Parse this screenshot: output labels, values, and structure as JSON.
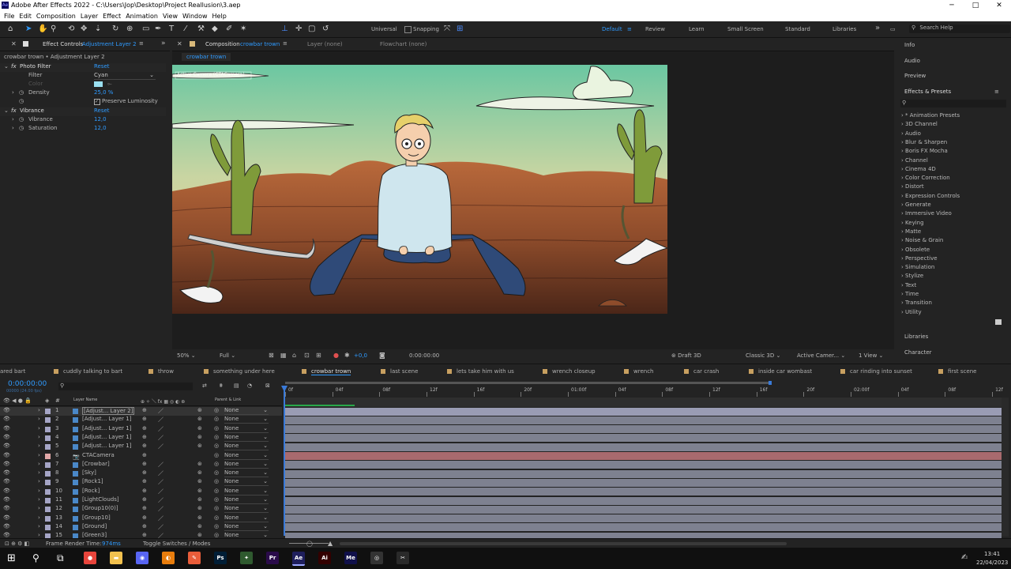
{
  "titlebar": {
    "app_initial": "Ae",
    "title": "Adobe After Effects 2022 - C:\\Users\\Jop\\Desktop\\Project Reallusion\\3.aep",
    "minimize": "─",
    "maximize": "□",
    "close": "✕"
  },
  "menu": [
    "File",
    "Edit",
    "Composition",
    "Layer",
    "Effect",
    "Animation",
    "View",
    "Window",
    "Help"
  ],
  "toolbar": {
    "universal_label": "Universal",
    "snapping_label": "Snapping",
    "search_label": "Search Help",
    "workspaces": [
      "Default",
      "Review",
      "Learn",
      "Small Screen",
      "Standard",
      "Libraries"
    ],
    "more": "»"
  },
  "effect_controls": {
    "tab_prefix": "Effect Controls",
    "tab_layer": "Adjustment Layer 2",
    "layer_path": "crowbar trown • Adjustment Layer 2",
    "fx": [
      {
        "name": "Photo Filter",
        "reset": "Reset"
      },
      {
        "name": "Vibrance",
        "reset": "Reset"
      }
    ],
    "photo_filter_rows": {
      "filter_label": "Filter",
      "filter_value": "Cyan",
      "color_label": "Color",
      "density_label": "Density",
      "density_value": "25,0 %",
      "preserve_label": "Preserve Luminosity"
    },
    "vibrance_rows": {
      "vibrance_label": "Vibrance",
      "vibrance_value": "12,0",
      "saturation_label": "Saturation",
      "saturation_value": "12,0"
    }
  },
  "viewer": {
    "comp_tab_prefix": "Composition",
    "comp_tab_name": "crowbar trown",
    "layer_tab": "Layer (none)",
    "flowchart_tab": "Flowchart (none)",
    "sub_tab": "crowbar trown",
    "overlay_text": "Active Camera (CTACamera)",
    "bottom": {
      "zoom": "50%",
      "quality": "Full",
      "exposure": "+0,0",
      "timecode": "0:00:00:00",
      "renderer": "Draft 3D",
      "renderer_mode": "Classic 3D",
      "camera": "Active Camer...",
      "views": "1 View"
    }
  },
  "right_panel": {
    "top_items": [
      "Info",
      "Audio",
      "Preview"
    ],
    "effects_title": "Effects & Presets",
    "effects": [
      "* Animation Presets",
      "3D Channel",
      "Audio",
      "Blur & Sharpen",
      "Boris FX Mocha",
      "Channel",
      "Cinema 4D",
      "Color Correction",
      "Distort",
      "Expression Controls",
      "Generate",
      "Immersive Video",
      "Keying",
      "Matte",
      "Noise & Grain",
      "Obsolete",
      "Perspective",
      "Simulation",
      "Stylize",
      "Text",
      "Time",
      "Transition",
      "Utility"
    ],
    "bottom_items": [
      "Libraries",
      "Character"
    ]
  },
  "timeline_tabs": [
    "ared bart",
    "cuddly talking to bart",
    "throw",
    "something under here",
    "crowbar trown",
    "last scene",
    "lets take him with us",
    "wrench closeup",
    "wrench",
    "car crash",
    "inside car wombast",
    "car rinding into sunset",
    "first scene"
  ],
  "timeline": {
    "timecode": "0:00:00:00",
    "fps": "00000 (24.00 fps)",
    "col_layer_name": "Layer Name",
    "col_num": "#",
    "col_parent": "Parent & Link",
    "ruler": [
      "0f",
      "04f",
      "08f",
      "12f",
      "16f",
      "20f",
      "01:00f",
      "04f",
      "08f",
      "12f",
      "16f",
      "20f",
      "02:00f",
      "04f",
      "08f",
      "12f"
    ],
    "layers": [
      {
        "num": "1",
        "name": "[Adjust... Layer 2]",
        "parent": "None",
        "color": "#a5a5c6",
        "selected": true
      },
      {
        "num": "2",
        "name": "[Adjust... Layer 1]",
        "parent": "None",
        "color": "#a5a5c6"
      },
      {
        "num": "3",
        "name": "[Adjust... Layer 1]",
        "parent": "None",
        "color": "#a5a5c6"
      },
      {
        "num": "4",
        "name": "[Adjust... Layer 1]",
        "parent": "None",
        "color": "#a5a5c6"
      },
      {
        "num": "5",
        "name": "[Adjust... Layer 1]",
        "parent": "None",
        "color": "#a5a5c6"
      },
      {
        "num": "6",
        "name": "CTACamera",
        "parent": "None",
        "color": "#e2a8a8"
      },
      {
        "num": "7",
        "name": "[Crowbar]",
        "parent": "None",
        "color": "#a5a5c6"
      },
      {
        "num": "8",
        "name": "[Sky]",
        "parent": "None",
        "color": "#a5a5c6"
      },
      {
        "num": "9",
        "name": "[Rock1]",
        "parent": "None",
        "color": "#a5a5c6"
      },
      {
        "num": "10",
        "name": "[Rock]",
        "parent": "None",
        "color": "#a5a5c6"
      },
      {
        "num": "11",
        "name": "[LightClouds]",
        "parent": "None",
        "color": "#a5a5c6"
      },
      {
        "num": "12",
        "name": "[Group10(0)]",
        "parent": "None",
        "color": "#a5a5c6"
      },
      {
        "num": "13",
        "name": "[Group10]",
        "parent": "None",
        "color": "#a5a5c6"
      },
      {
        "num": "14",
        "name": "[Ground]",
        "parent": "None",
        "color": "#a5a5c6"
      },
      {
        "num": "15",
        "name": "[Green3]",
        "parent": "None",
        "color": "#a5a5c6"
      }
    ],
    "footer_label": "Frame Render Time:",
    "footer_value": "974ms",
    "toggle_label": "Toggle Switches / Modes"
  },
  "taskbar": {
    "time": "13:41",
    "date": "22/04/2023",
    "apps": [
      {
        "name": "chrome",
        "label": "●",
        "color": "#e8453c"
      },
      {
        "name": "explorer",
        "label": "▬",
        "color": "#f2c14e"
      },
      {
        "name": "discord",
        "label": "◉",
        "color": "#5865f2"
      },
      {
        "name": "blender",
        "label": "◐",
        "color": "#e87d0d"
      },
      {
        "name": "pen",
        "label": "✎",
        "color": "#e85d3a"
      },
      {
        "name": "photoshop",
        "label": "Ps",
        "color": "#001e36"
      },
      {
        "name": "gear",
        "label": "✦",
        "color": "#2f5a2f"
      },
      {
        "name": "premiere",
        "label": "Pr",
        "color": "#2a0b4a"
      },
      {
        "name": "after-effects",
        "label": "Ae",
        "color": "#1f1f5c"
      },
      {
        "name": "illustrator",
        "label": "Ai",
        "color": "#330000"
      },
      {
        "name": "media-encoder",
        "label": "Me",
        "color": "#10104a"
      },
      {
        "name": "obs",
        "label": "◎",
        "color": "#333333"
      },
      {
        "name": "snip",
        "label": "✂",
        "color": "#2a2a2a"
      }
    ]
  }
}
